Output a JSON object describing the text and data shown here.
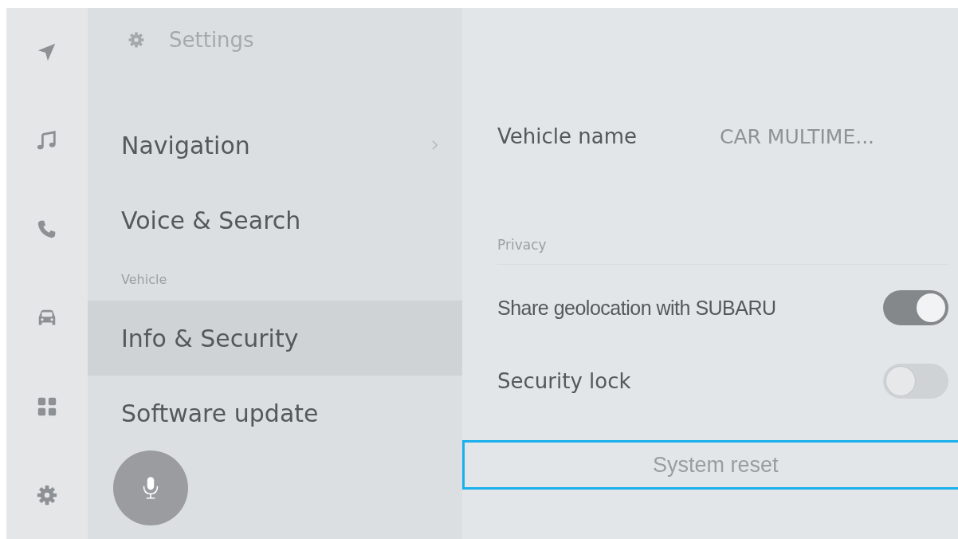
{
  "rail": {
    "items": [
      {
        "kind": "navigation"
      },
      {
        "kind": "music"
      },
      {
        "kind": "phone"
      },
      {
        "kind": "car"
      },
      {
        "kind": "apps"
      },
      {
        "kind": "settings"
      }
    ]
  },
  "menu": {
    "title": "Settings",
    "items": [
      {
        "kind": "item",
        "label": "Navigation",
        "selected": false,
        "chevron": true
      },
      {
        "kind": "item",
        "label": "Voice & Search",
        "selected": false,
        "chevron": false
      },
      {
        "kind": "section",
        "label": "Vehicle"
      },
      {
        "kind": "item",
        "label": "Info & Security",
        "selected": true,
        "chevron": false
      },
      {
        "kind": "item",
        "label": "Software update",
        "selected": false,
        "chevron": false
      }
    ],
    "voice_button": {
      "kind": "microphone"
    }
  },
  "detail": {
    "rows": [
      {
        "kind": "value",
        "label": "Vehicle name",
        "value": "CAR MULTIME..."
      },
      {
        "kind": "section",
        "label": "Privacy"
      },
      {
        "kind": "toggle",
        "label": "Share geolocation with SUBARU",
        "on": true
      },
      {
        "kind": "toggle",
        "label": "Security lock",
        "on": false
      },
      {
        "kind": "button",
        "label": "System reset",
        "focused": true
      }
    ]
  }
}
